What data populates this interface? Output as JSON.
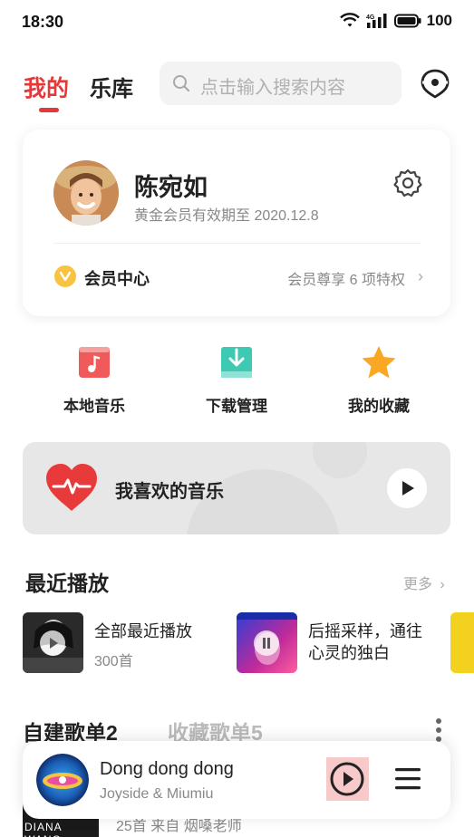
{
  "status_bar": {
    "time": "18:30",
    "network_label": "4G",
    "battery_percent": "100",
    "icons": [
      "wifi-icon",
      "signal-icon",
      "battery-icon"
    ]
  },
  "top_nav": {
    "tab_mine": "我的",
    "tab_library": "乐库",
    "active_tab": "我的",
    "search_placeholder": "点击输入搜索内容",
    "accent_color": "#e53838"
  },
  "profile": {
    "name": "陈宛如",
    "vip_expire": "黄金会员有效期至 2020.12.8",
    "member_center_label": "会员中心",
    "member_privilege_text": "会员尊享 6 项特权"
  },
  "quick_actions": [
    {
      "label": "本地音乐",
      "icon": "local-music-icon"
    },
    {
      "label": "下载管理",
      "icon": "download-icon"
    },
    {
      "label": "我的收藏",
      "icon": "star-icon"
    }
  ],
  "favorite_banner": {
    "label": "我喜欢的音乐"
  },
  "recent": {
    "section_title": "最近播放",
    "more_label": "更多",
    "items": [
      {
        "title": "全部最近播放",
        "subtitle": "300首",
        "state": "paused"
      },
      {
        "title_line1": "后摇采样，通往",
        "title_line2": "心灵的独白",
        "state": "playing"
      }
    ]
  },
  "playlists": {
    "tab_own": "自建歌单2",
    "tab_fav": "收藏歌单5",
    "partial_row_meta": "25首    来自 烟嗓老师",
    "partial_cover_text": "DIANA WANG"
  },
  "player": {
    "title": "Dong dong dong",
    "artist": "Joyside & Miumiu"
  }
}
